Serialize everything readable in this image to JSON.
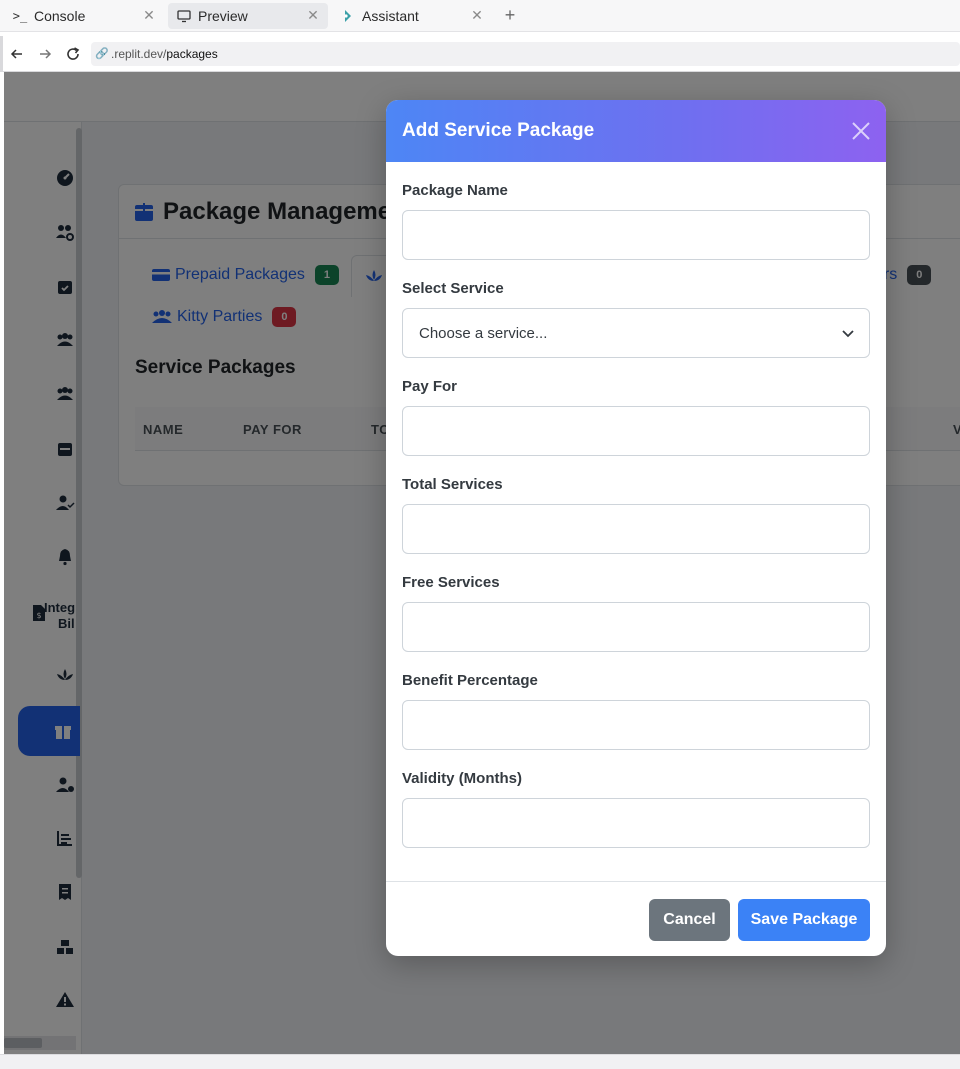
{
  "browser": {
    "tabs": [
      {
        "label": "Console",
        "icon": "terminal-icon"
      },
      {
        "label": "Preview",
        "icon": "monitor-icon"
      },
      {
        "label": "Assistant",
        "icon": "assistant-icon"
      }
    ],
    "new_tab": "+",
    "url_host": ".replit.dev/",
    "url_path": "packages"
  },
  "page": {
    "card_title": "Package Managemer",
    "tabs": [
      {
        "label": "Prepaid Packages",
        "count": "1",
        "badge_color": "#198754"
      },
      {
        "label": "ers",
        "count": "0",
        "badge_color": "#495057"
      },
      {
        "label": "Kitty Parties",
        "count": "0",
        "badge_color": "#dc3545"
      }
    ],
    "section_title": "Service Packages",
    "table_headers": [
      "NAME",
      "PAY FOR",
      "TO",
      "V"
    ],
    "sidebar": {
      "text_item_line1": "Integ",
      "text_item_line2": "Bil"
    }
  },
  "modal": {
    "title": "Add Service Package",
    "fields": [
      {
        "label": "Package Name",
        "value": "",
        "placeholder": ""
      },
      {
        "label": "Select Service",
        "selected": "Choose a service..."
      },
      {
        "label": "Pay For",
        "value": "",
        "placeholder": ""
      },
      {
        "label": "Total Services",
        "value": "",
        "placeholder": ""
      },
      {
        "label": "Free Services",
        "value": "",
        "placeholder": ""
      },
      {
        "label": "Benefit Percentage",
        "value": "",
        "placeholder": ""
      },
      {
        "label": "Validity (Months)",
        "value": "",
        "placeholder": ""
      }
    ],
    "cancel_label": "Cancel",
    "save_label": "Save Package"
  },
  "colors": {
    "header_gradient_start": "#4d86f5",
    "header_gradient_end": "#8d62f0",
    "primary": "#3b82f6",
    "secondary": "#6c757d"
  }
}
